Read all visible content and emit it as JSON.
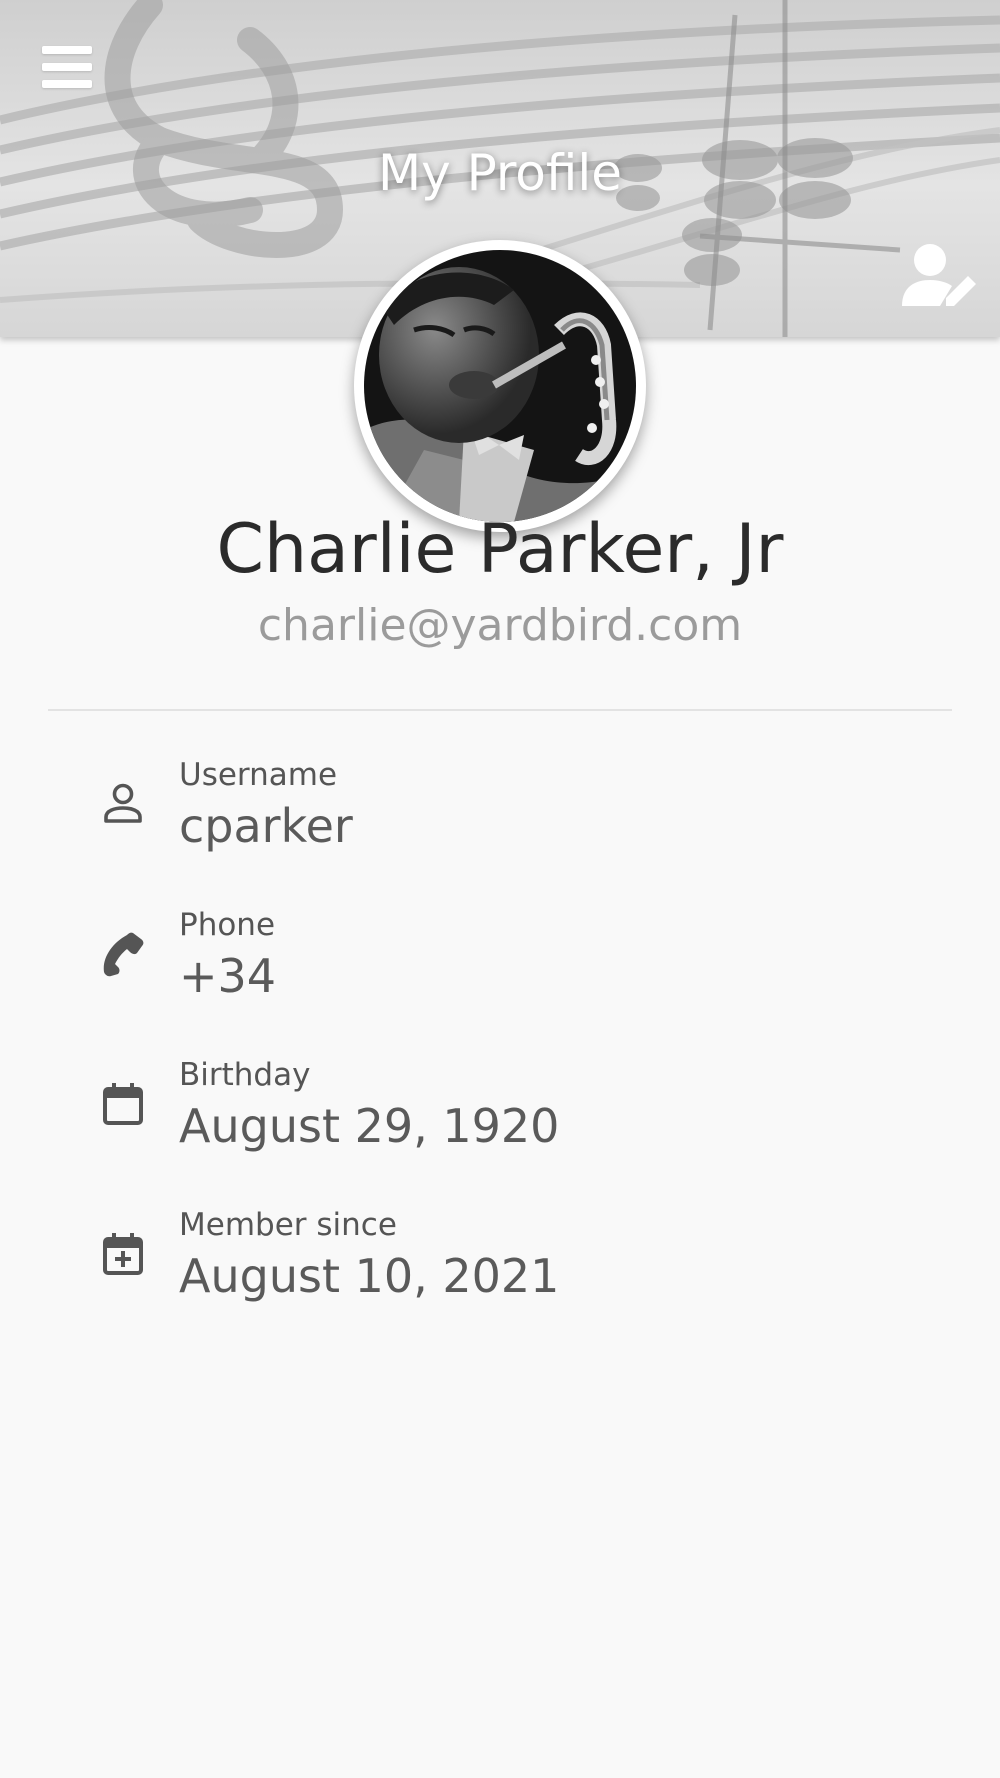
{
  "header": {
    "title": "My Profile",
    "menu_icon": "hamburger-menu-icon",
    "edit_icon": "user-edit-icon"
  },
  "profile": {
    "name": "Charlie Parker, Jr",
    "email": "charlie@yardbird.com",
    "avatar": "saxophone-player-photo"
  },
  "details": [
    {
      "icon": "user-icon",
      "label": "Username",
      "value": "cparker"
    },
    {
      "icon": "phone-icon",
      "label": "Phone",
      "value": "+34"
    },
    {
      "icon": "calendar-icon",
      "label": "Birthday",
      "value": "August 29, 1920"
    },
    {
      "icon": "calendar-plus-icon",
      "label": "Member since",
      "value": "August 10, 2021"
    }
  ],
  "colors": {
    "background": "#f9f9f9",
    "header_text": "#ffffff",
    "name_text": "#2b2b2b",
    "email_text": "#9b9b9b",
    "icon": "#555555"
  }
}
